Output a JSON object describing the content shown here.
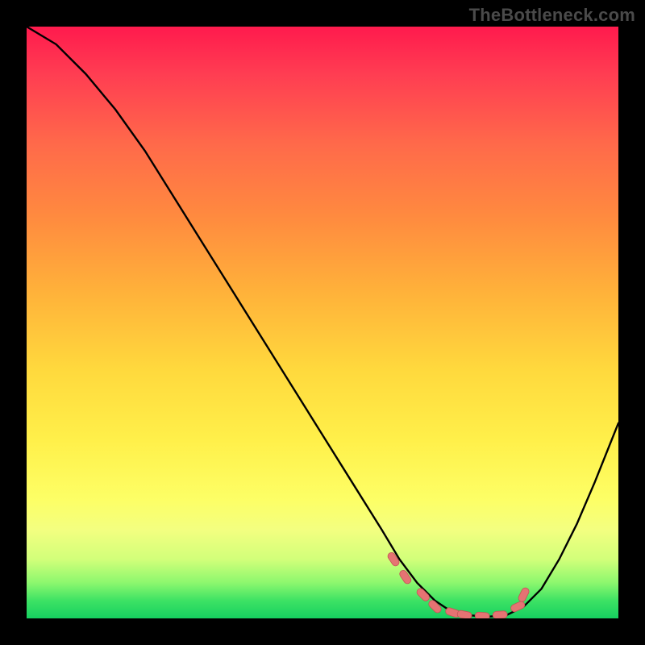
{
  "watermark": "TheBottleneck.com",
  "colors": {
    "background": "#000000",
    "curve": "#000000",
    "marker_fill": "#e57373",
    "marker_stroke": "#c45555",
    "gradient_stops": [
      "#ff1a4d",
      "#ff3d52",
      "#ff6a4a",
      "#ff8a3f",
      "#ffb23a",
      "#ffd93d",
      "#fff04a",
      "#fdff66",
      "#f3ff80",
      "#d2ff7a",
      "#8cf76e",
      "#3de264",
      "#16d060"
    ]
  },
  "chart_data": {
    "type": "line",
    "title": "",
    "xlabel": "",
    "ylabel": "",
    "xlim": [
      0,
      100
    ],
    "ylim": [
      0,
      100
    ],
    "series": [
      {
        "name": "curve",
        "x": [
          0,
          5,
          10,
          15,
          20,
          25,
          30,
          35,
          40,
          45,
          50,
          55,
          60,
          63,
          66,
          69,
          72,
          75,
          78,
          81,
          84,
          87,
          90,
          93,
          96,
          100
        ],
        "values": [
          100,
          97,
          92,
          86,
          79,
          71,
          63,
          55,
          47,
          39,
          31,
          23,
          15,
          10,
          6,
          3,
          1,
          0.5,
          0.3,
          0.5,
          2,
          5,
          10,
          16,
          23,
          33
        ]
      }
    ],
    "markers": {
      "x": [
        62,
        64,
        67,
        69,
        72,
        74,
        77,
        80,
        83,
        84
      ],
      "values": [
        10,
        7,
        4,
        2,
        1,
        0.6,
        0.4,
        0.6,
        2,
        4
      ]
    }
  }
}
